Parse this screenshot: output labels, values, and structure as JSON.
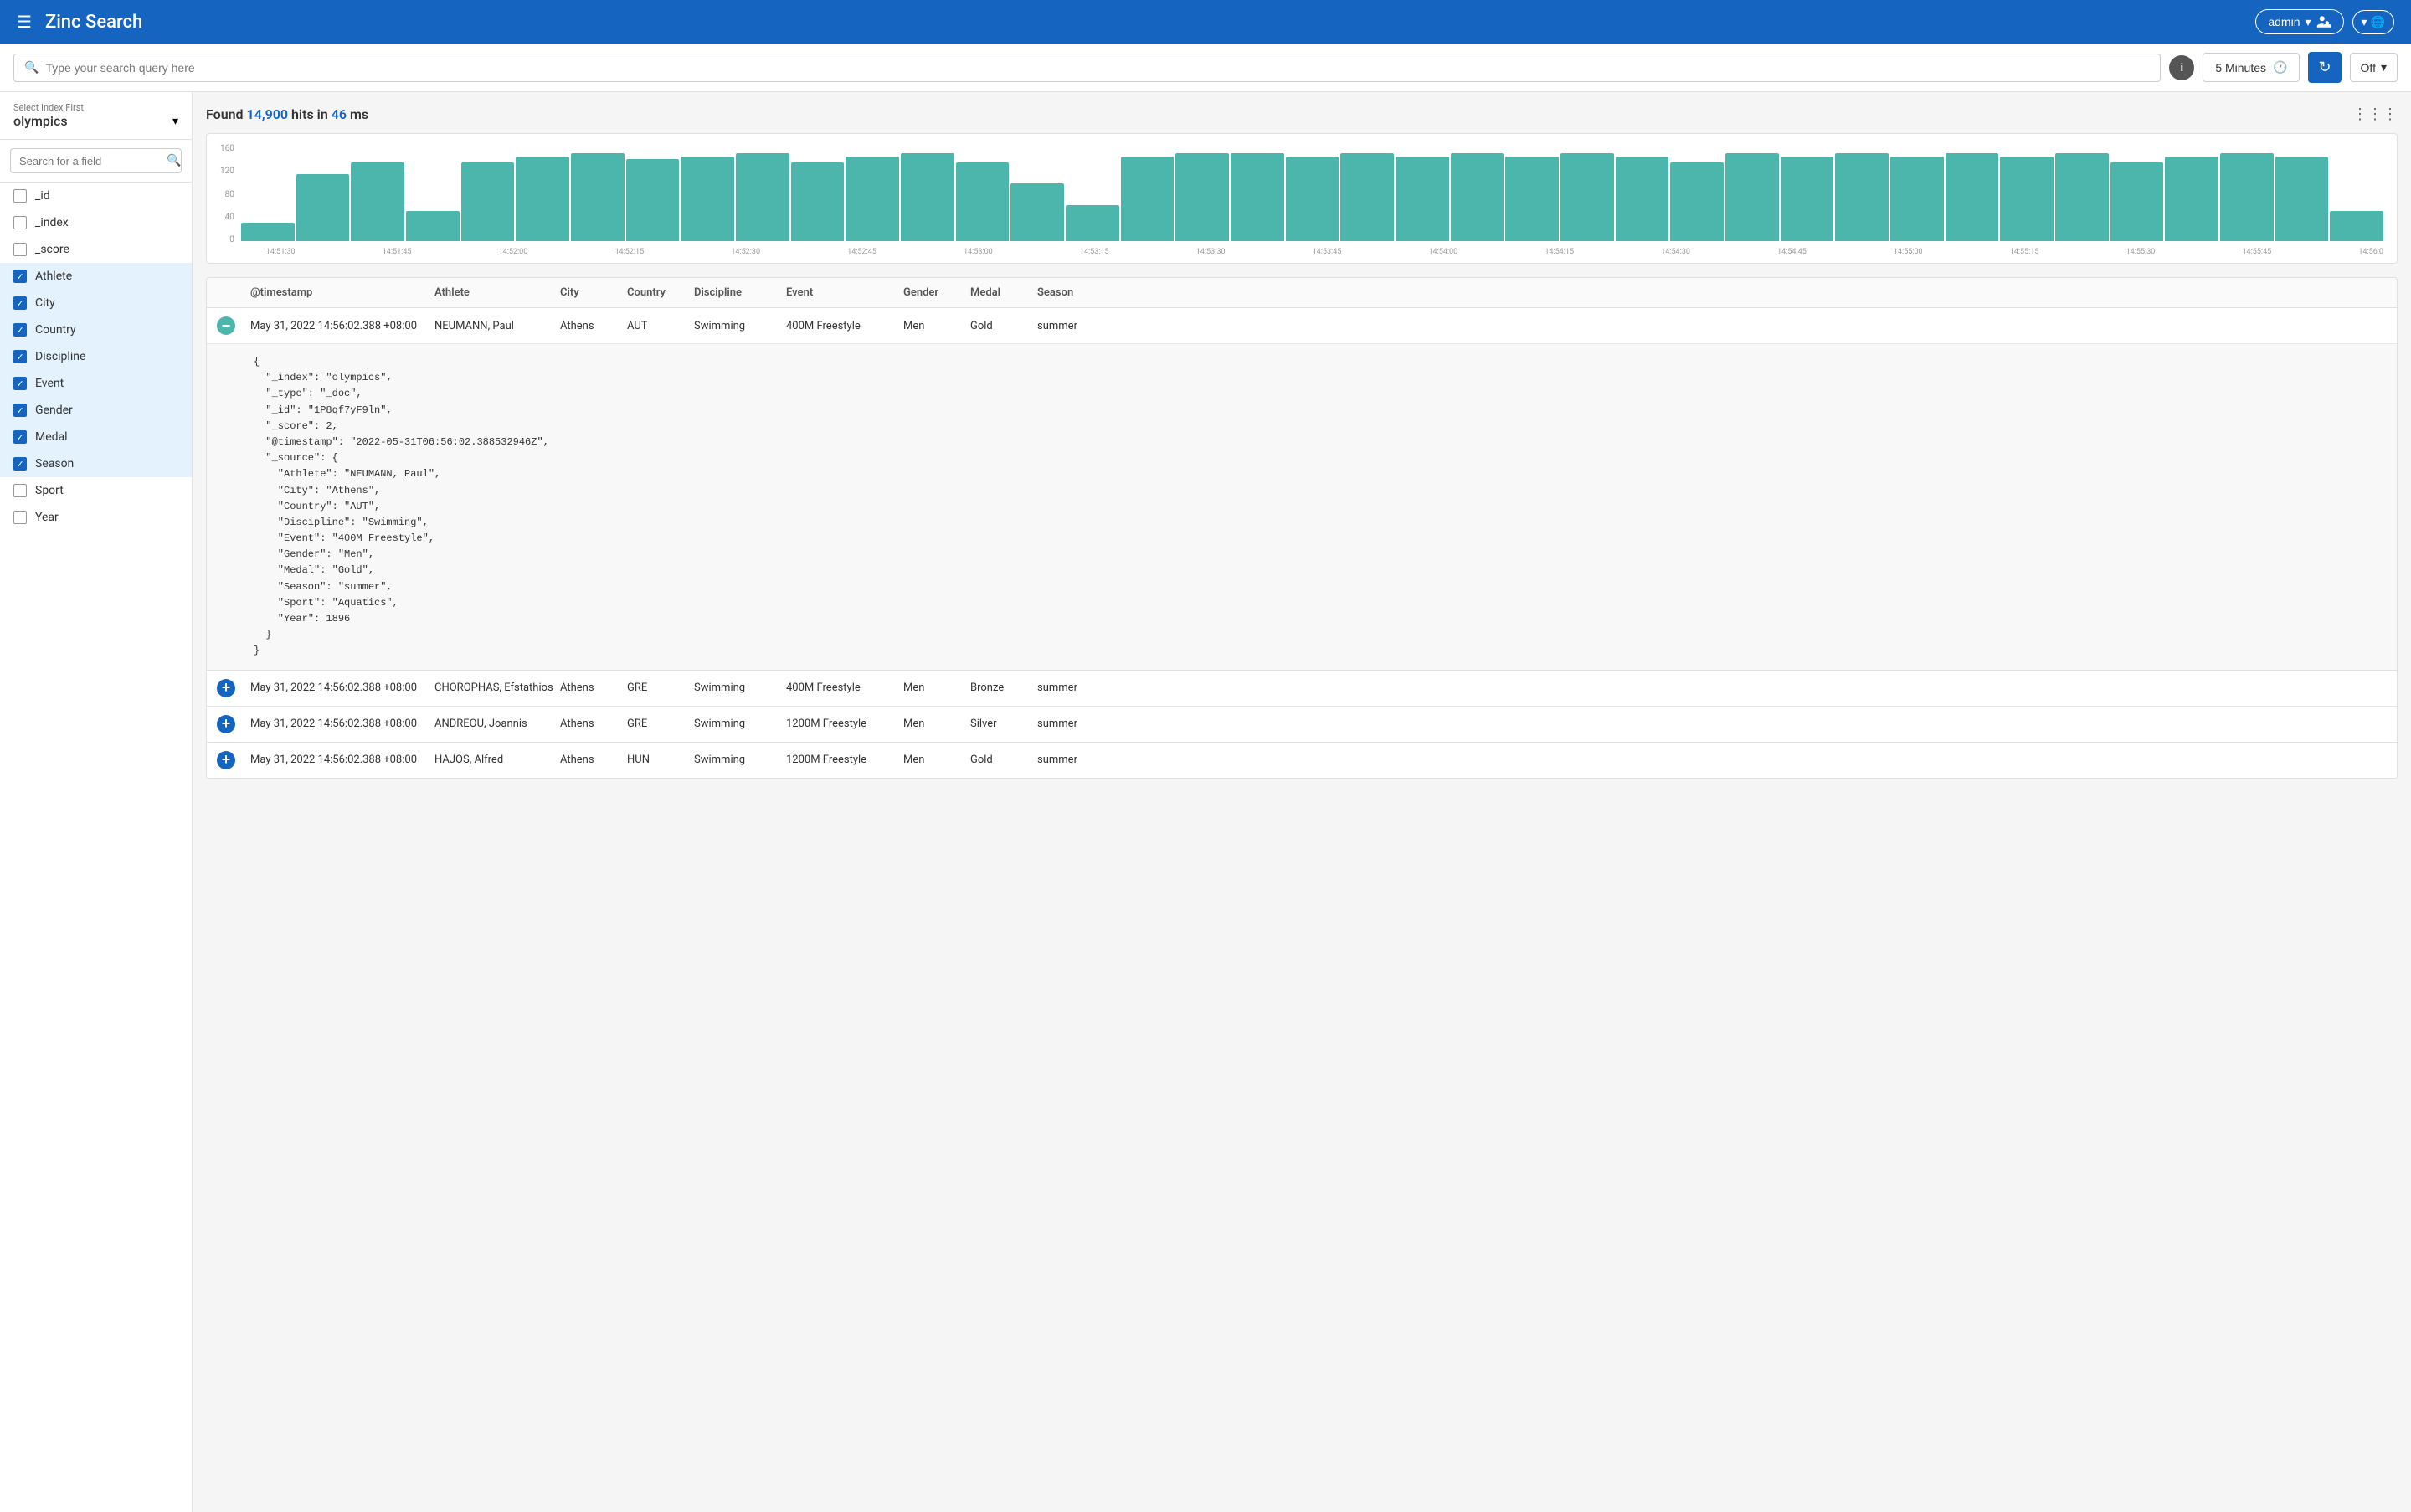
{
  "header": {
    "menu_icon": "☰",
    "title": "Zinc Search",
    "admin_label": "admin",
    "chevron_down": "▾",
    "globe_icon": "🌐"
  },
  "search_bar": {
    "placeholder": "Type your search query here",
    "time_range": "5 Minutes",
    "clock_icon": "🕐",
    "auto_refresh_label": "Off",
    "info_icon": "i"
  },
  "sidebar": {
    "index_label": "Select Index First",
    "index_name": "olympics",
    "field_search_placeholder": "Search for a field",
    "fields": [
      {
        "name": "_id",
        "checked": false
      },
      {
        "name": "_index",
        "checked": false
      },
      {
        "name": "_score",
        "checked": false
      },
      {
        "name": "Athlete",
        "checked": true
      },
      {
        "name": "City",
        "checked": true
      },
      {
        "name": "Country",
        "checked": true
      },
      {
        "name": "Discipline",
        "checked": true
      },
      {
        "name": "Event",
        "checked": true
      },
      {
        "name": "Gender",
        "checked": true
      },
      {
        "name": "Medal",
        "checked": true
      },
      {
        "name": "Season",
        "checked": true
      },
      {
        "name": "Sport",
        "checked": false
      },
      {
        "name": "Year",
        "checked": false
      }
    ]
  },
  "results": {
    "title": "Found 14,900 hits in 46 ms",
    "hit_count": "14,900",
    "time_ms": "46"
  },
  "chart": {
    "y_labels": [
      "160",
      "120",
      "80",
      "40",
      "0"
    ],
    "x_labels": [
      "14:51:30",
      "14:51:45",
      "14:52:00",
      "14:52:15",
      "14:52:30",
      "14:52:45",
      "14:53:00",
      "14:53:15",
      "14:53:30",
      "14:53:45",
      "14:54:00",
      "14:54:15",
      "14:54:30",
      "14:54:45",
      "14:55:00",
      "14:55:15",
      "14:55:30",
      "14:55:45",
      "14:56:0"
    ],
    "bars": [
      30,
      110,
      130,
      50,
      130,
      140,
      145,
      135,
      140,
      145,
      130,
      140,
      145,
      130,
      95,
      60,
      140,
      145,
      145,
      140,
      145,
      140,
      145,
      140,
      145,
      140,
      130,
      145,
      140,
      145,
      140,
      145,
      140,
      145,
      130,
      140,
      145,
      140,
      50
    ]
  },
  "table": {
    "columns": [
      "@timestamp",
      "Athlete",
      "City",
      "Country",
      "Discipline",
      "Event",
      "Gender",
      "Medal",
      "Season"
    ],
    "rows": [
      {
        "expanded": true,
        "timestamp": "May 31, 2022 14:56:02.388 +08:00",
        "athlete": "NEUMANN, Paul",
        "city": "Athens",
        "country": "AUT",
        "discipline": "Swimming",
        "event": "400M Freestyle",
        "gender": "Men",
        "medal": "Gold",
        "season": "summer",
        "json": "{\n  \"_index\": \"olympics\",\n  \"_type\": \"_doc\",\n  \"_id\": \"1P8qf7yF9ln\",\n  \"_score\": 2,\n  \"@timestamp\": \"2022-05-31T06:56:02.388532946Z\",\n  \"_source\": {\n    \"Athlete\": \"NEUMANN, Paul\",\n    \"City\": \"Athens\",\n    \"Country\": \"AUT\",\n    \"Discipline\": \"Swimming\",\n    \"Event\": \"400M Freestyle\",\n    \"Gender\": \"Men\",\n    \"Medal\": \"Gold\",\n    \"Season\": \"summer\",\n    \"Sport\": \"Aquatics\",\n    \"Year\": 1896\n  }\n}"
      },
      {
        "expanded": false,
        "timestamp": "May 31, 2022 14:56:02.388 +08:00",
        "athlete": "CHOROPHAS, Efstathios",
        "city": "Athens",
        "country": "GRE",
        "discipline": "Swimming",
        "event": "400M Freestyle",
        "gender": "Men",
        "medal": "Bronze",
        "season": "summer",
        "json": ""
      },
      {
        "expanded": false,
        "timestamp": "May 31, 2022 14:56:02.388 +08:00",
        "athlete": "ANDREOU, Joannis",
        "city": "Athens",
        "country": "GRE",
        "discipline": "Swimming",
        "event": "1200M Freestyle",
        "gender": "Men",
        "medal": "Silver",
        "season": "summer",
        "json": ""
      },
      {
        "expanded": false,
        "timestamp": "May 31, 2022 14:56:02.388 +08:00",
        "athlete": "HAJOS, Alfred",
        "city": "Athens",
        "country": "HUN",
        "discipline": "Swimming",
        "event": "1200M Freestyle",
        "gender": "Men",
        "medal": "Gold",
        "season": "summer",
        "json": ""
      }
    ]
  }
}
